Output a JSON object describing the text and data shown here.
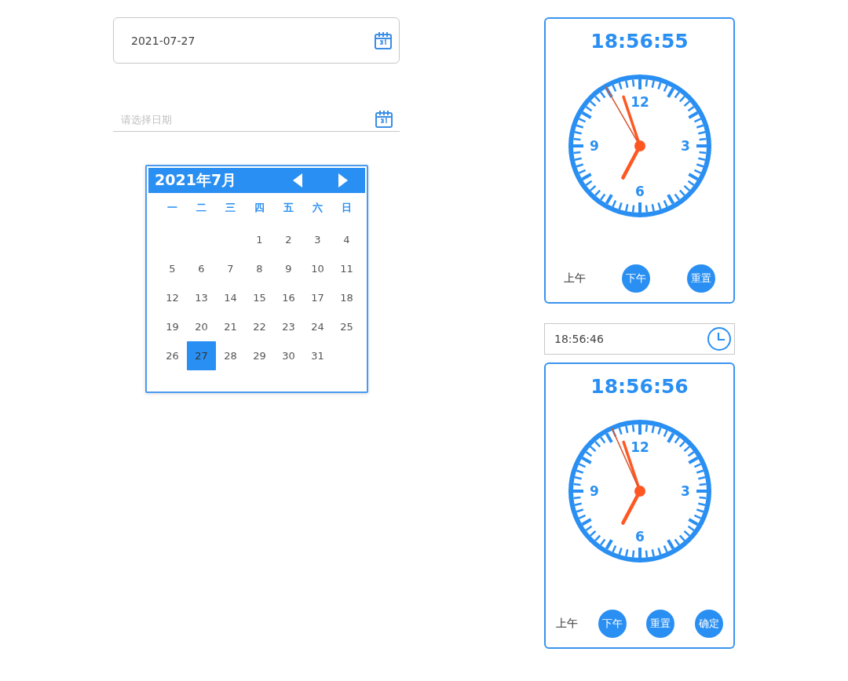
{
  "date_fields": [
    {
      "kind": "boxed",
      "value": "2021-07-27"
    },
    {
      "kind": "underline",
      "placeholder": "请选择日期"
    }
  ],
  "calendar": {
    "title": "2021年7月",
    "weekdays": [
      "一",
      "二",
      "三",
      "四",
      "五",
      "六",
      "日"
    ],
    "weeks": [
      [
        {
          "day": "1",
          "selected": false
        },
        {
          "day": "2",
          "selected": false
        },
        {
          "day": "3",
          "selected": false
        },
        {
          "day": "4",
          "selected": false
        }
      ],
      [
        {
          "day": "5",
          "selected": false
        },
        {
          "day": "6",
          "selected": false
        },
        {
          "day": "7",
          "selected": false
        },
        {
          "day": "8",
          "selected": false
        },
        {
          "day": "9",
          "selected": false
        },
        {
          "day": "10",
          "selected": false
        },
        {
          "day": "11",
          "selected": false
        }
      ],
      [
        {
          "day": "12",
          "selected": false
        },
        {
          "day": "13",
          "selected": false
        },
        {
          "day": "14",
          "selected": false
        },
        {
          "day": "15",
          "selected": false
        },
        {
          "day": "16",
          "selected": false
        },
        {
          "day": "17",
          "selected": false
        },
        {
          "day": "18",
          "selected": false
        }
      ],
      [
        {
          "day": "19",
          "selected": false
        },
        {
          "day": "20",
          "selected": false
        },
        {
          "day": "21",
          "selected": false
        },
        {
          "day": "22",
          "selected": false
        },
        {
          "day": "23",
          "selected": false
        },
        {
          "day": "24",
          "selected": false
        },
        {
          "day": "25",
          "selected": false
        }
      ],
      [
        {
          "day": "26",
          "selected": false
        },
        {
          "day": "27",
          "selected": true
        },
        {
          "day": "28",
          "selected": false
        },
        {
          "day": "29",
          "selected": false
        },
        {
          "day": "30",
          "selected": false
        },
        {
          "day": "31",
          "selected": false
        }
      ]
    ]
  },
  "clock_panel": {
    "time": "18:56:55",
    "dial": [
      "12",
      "3",
      "6",
      "9"
    ],
    "buttons": [
      {
        "label": "上午",
        "kind": "text"
      },
      {
        "label": "下午",
        "kind": "round"
      },
      {
        "label": "重置",
        "kind": "round"
      }
    ]
  },
  "time_field": {
    "value": "18:56:46"
  },
  "time_picker_panel": {
    "time": "18:56:56",
    "dial": [
      "12",
      "3",
      "6",
      "9"
    ],
    "buttons": [
      {
        "label": "上午",
        "kind": "text"
      },
      {
        "label": "下午",
        "kind": "round"
      },
      {
        "label": "重置",
        "kind": "round"
      },
      {
        "label": "确定",
        "kind": "round"
      }
    ]
  }
}
